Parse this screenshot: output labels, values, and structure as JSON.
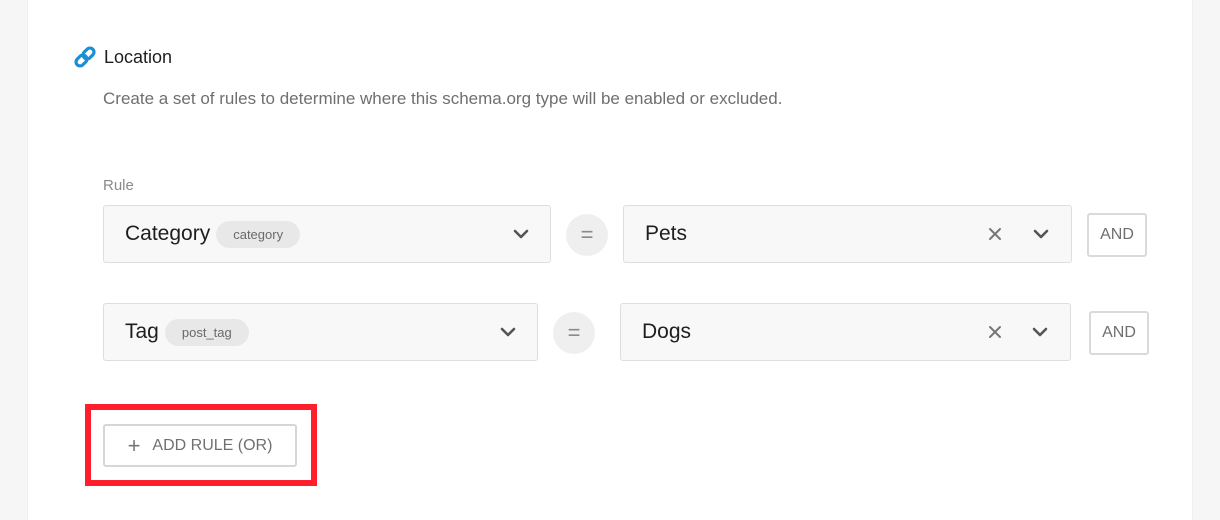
{
  "section": {
    "title": "Location",
    "description": "Create a set of rules to determine where this schema.org type will be enabled or excluded."
  },
  "rule_label": "Rule",
  "rules": [
    {
      "taxonomy": "Category",
      "taxonomy_slug": "category",
      "operator": "=",
      "value": "Pets",
      "connector": "AND"
    },
    {
      "taxonomy": "Tag",
      "taxonomy_slug": "post_tag",
      "operator": "=",
      "value": "Dogs",
      "connector": "AND"
    }
  ],
  "add_rule_label": "ADD RULE (OR)",
  "colors": {
    "highlight": "#ff1f2c",
    "link_icon": "#1a8fd6"
  }
}
